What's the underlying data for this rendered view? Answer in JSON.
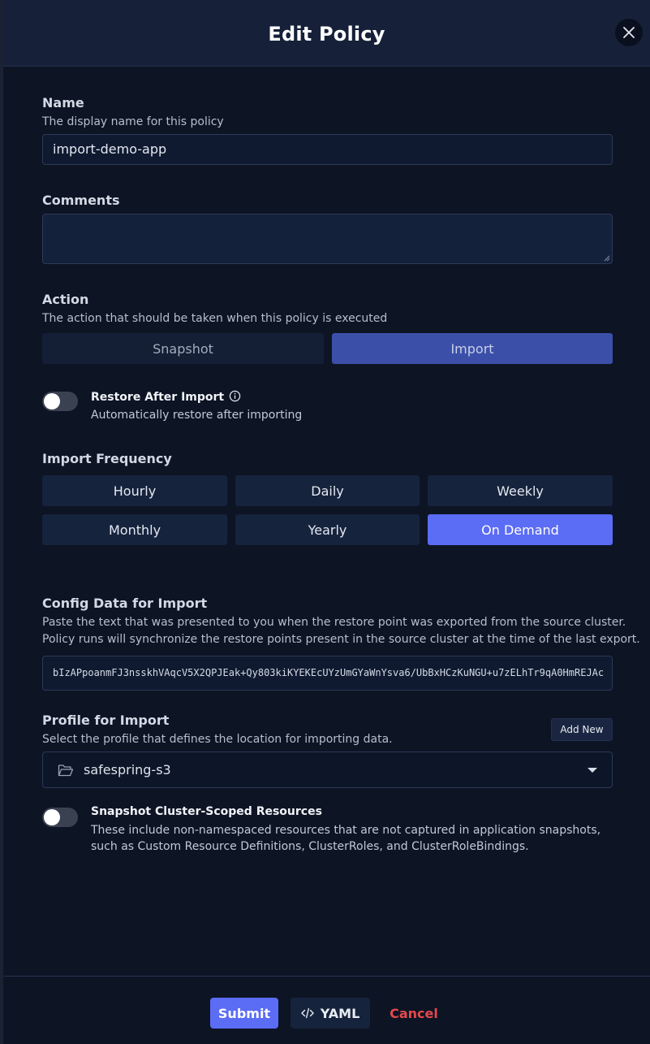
{
  "modal": {
    "title": "Edit Policy"
  },
  "name": {
    "label": "Name",
    "help": "The display name for this policy",
    "value": "import-demo-app"
  },
  "comments": {
    "label": "Comments",
    "value": ""
  },
  "action": {
    "label": "Action",
    "help": "The action that should be taken when this policy is executed",
    "options": [
      "Snapshot",
      "Import"
    ],
    "selected": "Import"
  },
  "restore_after_import": {
    "title": "Restore After Import",
    "description": "Automatically restore after importing",
    "enabled": false
  },
  "import_frequency": {
    "label": "Import Frequency",
    "options": [
      "Hourly",
      "Daily",
      "Weekly",
      "Monthly",
      "Yearly",
      "On Demand"
    ],
    "selected": "On Demand"
  },
  "config_data": {
    "label": "Config Data for Import",
    "help_line1": "Paste the text that was presented to you when the restore point was exported from the source cluster.",
    "help_line2": "Policy runs will synchronize the restore points present in the source cluster at the time of the last export.",
    "value": "bIzAPpoanmFJ3nsskhVAqcV5X2QPJEak+Qy803kiKYEKEcUYzUmGYaWnYsva6/UbBxHCzKuNGU+u7zELhTr9qA0HmREJAc"
  },
  "profile": {
    "label": "Profile for Import",
    "help": "Select the profile that defines the location for importing data.",
    "add_new_label": "Add New",
    "selected": "safespring-s3",
    "icon": "folder-open-icon"
  },
  "cluster_scoped": {
    "title": "Snapshot Cluster-Scoped Resources",
    "description": "These include non-namespaced resources that are not captured in application snapshots, such as Custom Resource Definitions, ClusterRoles, and ClusterRoleBindings.",
    "enabled": false
  },
  "footer": {
    "submit_label": "Submit",
    "yaml_label": "YAML",
    "cancel_label": "Cancel"
  },
  "colors": {
    "accent": "#5b6cf5",
    "danger": "#e5484d",
    "background": "#0d1424"
  }
}
